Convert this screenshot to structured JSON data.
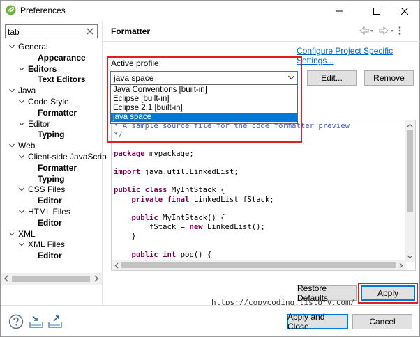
{
  "window": {
    "title": "Preferences",
    "minimize_icon": "minimize-icon",
    "maximize_icon": "maximize-icon",
    "close_icon": "close-icon"
  },
  "filter": {
    "value": "tab"
  },
  "tree": [
    {
      "label": "General",
      "bold": false,
      "expanded": true
    },
    {
      "label": "Appearance",
      "bold": true
    },
    {
      "label": "Editors",
      "bold": true,
      "expanded": true
    },
    {
      "label": "Text Editors",
      "bold": true
    },
    {
      "label": "Java",
      "bold": false,
      "expanded": true
    },
    {
      "label": "Code Style",
      "bold": false,
      "expanded": true
    },
    {
      "label": "Formatter",
      "bold": true,
      "selected": true
    },
    {
      "label": "Editor",
      "bold": false,
      "expanded": true
    },
    {
      "label": "Typing",
      "bold": true
    },
    {
      "label": "Web",
      "bold": false,
      "expanded": true
    },
    {
      "label": "Client-side JavaScrip",
      "bold": false,
      "expanded": true
    },
    {
      "label": "Formatter",
      "bold": true
    },
    {
      "label": "Typing",
      "bold": true
    },
    {
      "label": "CSS Files",
      "bold": false,
      "expanded": true
    },
    {
      "label": "Editor",
      "bold": true
    },
    {
      "label": "HTML Files",
      "bold": false,
      "expanded": true
    },
    {
      "label": "Editor",
      "bold": true
    },
    {
      "label": "XML",
      "bold": false,
      "expanded": true
    },
    {
      "label": "XML Files",
      "bold": false,
      "expanded": true
    },
    {
      "label": "Editor",
      "bold": true
    }
  ],
  "page": {
    "heading": "Formatter",
    "configure_link": "Configure Project Specific Settings...",
    "active_profile_label": "Active profile:",
    "profile_value": "java space",
    "edit_button": "Edit...",
    "remove_button": "Remove",
    "profile_options": [
      {
        "label": "Java Conventions [built-in]",
        "selected": false
      },
      {
        "label": "Eclipse [built-in]",
        "selected": false
      },
      {
        "label": "Eclipse 2.1 [built-in]",
        "selected": false
      },
      {
        "label": "java space",
        "selected": true
      }
    ],
    "code_lines": [
      [
        [
          "cm",
          "* A sample source file for the code formatter preview"
        ]
      ],
      [
        [
          "cm",
          "*/"
        ]
      ],
      [],
      [
        [
          "kw",
          "package"
        ],
        [
          "",
          "mypackage;"
        ]
      ],
      [],
      [
        [
          "kw",
          "import"
        ],
        [
          "",
          "java.util.LinkedList;"
        ]
      ],
      [],
      [
        [
          "kw",
          "public class"
        ],
        [
          "",
          "MyIntStack {"
        ]
      ],
      [
        [
          "",
          "    "
        ],
        [
          "kw",
          "private final"
        ],
        [
          "",
          "LinkedList fStack;"
        ]
      ],
      [],
      [
        [
          "",
          "    "
        ],
        [
          "kw",
          "public"
        ],
        [
          "",
          "MyIntStack() {"
        ]
      ],
      [
        [
          "",
          "        fStack = "
        ],
        [
          "kw",
          "new"
        ],
        [
          "",
          "LinkedList();"
        ]
      ],
      [
        [
          "",
          "    }"
        ]
      ],
      [],
      [
        [
          "",
          "    "
        ],
        [
          "kw",
          "public int"
        ],
        [
          "",
          "pop() {"
        ]
      ]
    ],
    "restore_defaults_button": "Restore Defaults",
    "apply_button": "Apply"
  },
  "watermark": "https://copycoding.tistory.com/",
  "footer": {
    "help_icon": "help-icon",
    "import_icon": "import-icon",
    "export_icon": "export-icon",
    "apply_close_button": "Apply and Close",
    "cancel_button": "Cancel"
  },
  "colors": {
    "accent": "#0078d7",
    "highlight": "#e02020",
    "link": "#0066cc",
    "keyword": "#7f0055",
    "comment": "#3f5fbf"
  }
}
